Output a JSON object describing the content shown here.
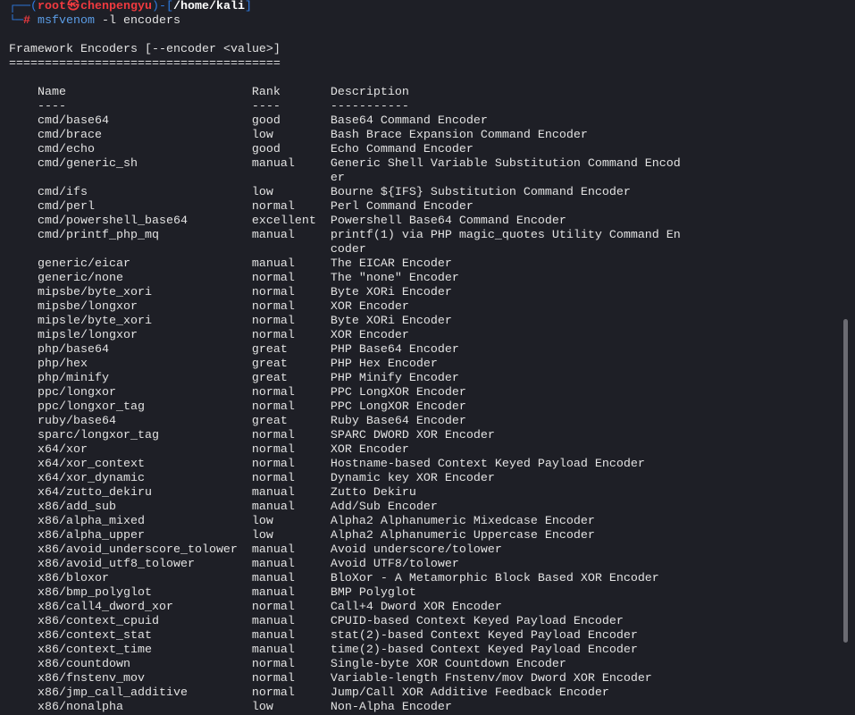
{
  "prompt": {
    "corner_top": "┌──(",
    "user": "root",
    "symbol": "㉿",
    "host": "chenpengyu",
    "separator": ")-[",
    "cwd": "/home/kali",
    "close": "]",
    "corner_bottom": "└─",
    "prompt_char": "#",
    "command": "msfvenom",
    "args": "-l encoders"
  },
  "section": {
    "title": "Framework Encoders [--encoder <value>]",
    "rule": "======================================"
  },
  "table": {
    "columns": [
      {
        "label": "Name",
        "rule": "----"
      },
      {
        "label": "Rank",
        "rule": "----"
      },
      {
        "label": "Description",
        "rule": "-----------"
      }
    ],
    "rows": [
      {
        "name": "cmd/base64",
        "rank": "good",
        "description": "Base64 Command Encoder"
      },
      {
        "name": "cmd/brace",
        "rank": "low",
        "description": "Bash Brace Expansion Command Encoder"
      },
      {
        "name": "cmd/echo",
        "rank": "good",
        "description": "Echo Command Encoder"
      },
      {
        "name": "cmd/generic_sh",
        "rank": "manual",
        "description": "Generic Shell Variable Substitution Command Encoder"
      },
      {
        "name": "cmd/ifs",
        "rank": "low",
        "description": "Bourne ${IFS} Substitution Command Encoder"
      },
      {
        "name": "cmd/perl",
        "rank": "normal",
        "description": "Perl Command Encoder"
      },
      {
        "name": "cmd/powershell_base64",
        "rank": "excellent",
        "description": "Powershell Base64 Command Encoder"
      },
      {
        "name": "cmd/printf_php_mq",
        "rank": "manual",
        "description": "printf(1) via PHP magic_quotes Utility Command Encoder"
      },
      {
        "name": "generic/eicar",
        "rank": "manual",
        "description": "The EICAR Encoder"
      },
      {
        "name": "generic/none",
        "rank": "normal",
        "description": "The \"none\" Encoder"
      },
      {
        "name": "mipsbe/byte_xori",
        "rank": "normal",
        "description": "Byte XORi Encoder"
      },
      {
        "name": "mipsbe/longxor",
        "rank": "normal",
        "description": "XOR Encoder"
      },
      {
        "name": "mipsle/byte_xori",
        "rank": "normal",
        "description": "Byte XORi Encoder"
      },
      {
        "name": "mipsle/longxor",
        "rank": "normal",
        "description": "XOR Encoder"
      },
      {
        "name": "php/base64",
        "rank": "great",
        "description": "PHP Base64 Encoder"
      },
      {
        "name": "php/hex",
        "rank": "great",
        "description": "PHP Hex Encoder"
      },
      {
        "name": "php/minify",
        "rank": "great",
        "description": "PHP Minify Encoder"
      },
      {
        "name": "ppc/longxor",
        "rank": "normal",
        "description": "PPC LongXOR Encoder"
      },
      {
        "name": "ppc/longxor_tag",
        "rank": "normal",
        "description": "PPC LongXOR Encoder"
      },
      {
        "name": "ruby/base64",
        "rank": "great",
        "description": "Ruby Base64 Encoder"
      },
      {
        "name": "sparc/longxor_tag",
        "rank": "normal",
        "description": "SPARC DWORD XOR Encoder"
      },
      {
        "name": "x64/xor",
        "rank": "normal",
        "description": "XOR Encoder"
      },
      {
        "name": "x64/xor_context",
        "rank": "normal",
        "description": "Hostname-based Context Keyed Payload Encoder"
      },
      {
        "name": "x64/xor_dynamic",
        "rank": "normal",
        "description": "Dynamic key XOR Encoder"
      },
      {
        "name": "x64/zutto_dekiru",
        "rank": "manual",
        "description": "Zutto Dekiru"
      },
      {
        "name": "x86/add_sub",
        "rank": "manual",
        "description": "Add/Sub Encoder"
      },
      {
        "name": "x86/alpha_mixed",
        "rank": "low",
        "description": "Alpha2 Alphanumeric Mixedcase Encoder"
      },
      {
        "name": "x86/alpha_upper",
        "rank": "low",
        "description": "Alpha2 Alphanumeric Uppercase Encoder"
      },
      {
        "name": "x86/avoid_underscore_tolower",
        "rank": "manual",
        "description": "Avoid underscore/tolower"
      },
      {
        "name": "x86/avoid_utf8_tolower",
        "rank": "manual",
        "description": "Avoid UTF8/tolower"
      },
      {
        "name": "x86/bloxor",
        "rank": "manual",
        "description": "BloXor - A Metamorphic Block Based XOR Encoder"
      },
      {
        "name": "x86/bmp_polyglot",
        "rank": "manual",
        "description": "BMP Polyglot"
      },
      {
        "name": "x86/call4_dword_xor",
        "rank": "normal",
        "description": "Call+4 Dword XOR Encoder"
      },
      {
        "name": "x86/context_cpuid",
        "rank": "manual",
        "description": "CPUID-based Context Keyed Payload Encoder"
      },
      {
        "name": "x86/context_stat",
        "rank": "manual",
        "description": "stat(2)-based Context Keyed Payload Encoder"
      },
      {
        "name": "x86/context_time",
        "rank": "manual",
        "description": "time(2)-based Context Keyed Payload Encoder"
      },
      {
        "name": "x86/countdown",
        "rank": "normal",
        "description": "Single-byte XOR Countdown Encoder"
      },
      {
        "name": "x86/fnstenv_mov",
        "rank": "normal",
        "description": "Variable-length Fnstenv/mov Dword XOR Encoder"
      },
      {
        "name": "x86/jmp_call_additive",
        "rank": "normal",
        "description": "Jump/Call XOR Additive Feedback Encoder"
      },
      {
        "name": "x86/nonalpha",
        "rank": "low",
        "description": "Non-Alpha Encoder"
      }
    ]
  },
  "colors": {
    "background": "#1e1f26",
    "text": "#e2e2e2",
    "prompt_blue": "#2f7be0",
    "prompt_red": "#ef3a3f",
    "command": "#5b9de6",
    "scrollbar_thumb": "#6b6b72"
  }
}
